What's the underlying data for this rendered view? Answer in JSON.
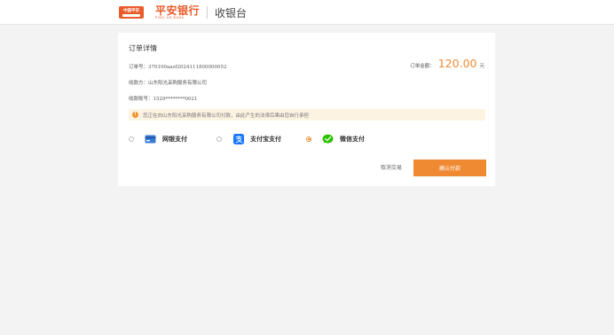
{
  "header": {
    "bank_badge_text": "中国平安",
    "bank_name": "平安银行",
    "bank_name_en": "PING AN BANK",
    "page_title": "收银台"
  },
  "order": {
    "section_title": "订单详情",
    "order_no_label": "订单号：",
    "order_no": "370100aazf2024111800000052",
    "payee_label": "收款方：",
    "payee": "山东阳光采购服务有限公司",
    "payee_account_label": "收款账号：",
    "payee_account": "1529********0021",
    "amount_label": "订单金额：",
    "amount": "120.00",
    "amount_unit": "元"
  },
  "notice": {
    "text": "您正在向山东阳光采购服务有限公司付款，由此产生的法律后果由您自行承担"
  },
  "payment_methods": [
    {
      "label": "网银支付",
      "icon": "bank-card-icon",
      "selected": false
    },
    {
      "label": "支付宝支付",
      "icon": "alipay-icon",
      "selected": false
    },
    {
      "label": "微信支付",
      "icon": "wechat-pay-icon",
      "selected": true
    }
  ],
  "actions": {
    "cancel_label": "取消交易",
    "confirm_label": "确认付款"
  },
  "colors": {
    "brand": "#ea5b2a",
    "accent": "#f08a32",
    "notice_bg": "#fdf3e2",
    "bank_icon": "#3a7bd5",
    "alipay_icon": "#1677ff",
    "wechat_icon": "#2dc100"
  }
}
